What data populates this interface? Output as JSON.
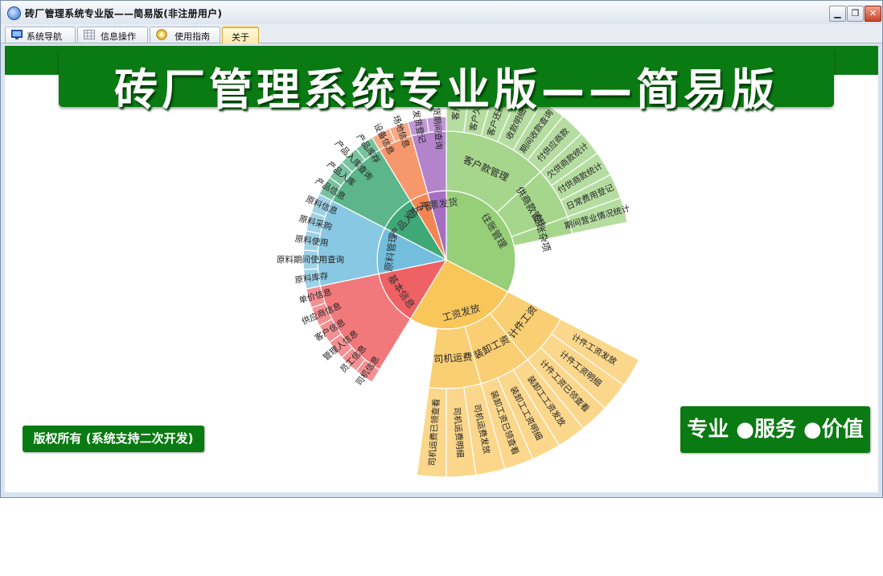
{
  "window": {
    "title": "砖厂管理系统专业版——简易版(非注册用户)",
    "buttons": [
      "minimize",
      "maximize",
      "close"
    ]
  },
  "tabs": [
    {
      "label": "系统导航",
      "icon": "monitor-icon",
      "active": false
    },
    {
      "label": "信息操作",
      "icon": "grid-icon",
      "active": false
    },
    {
      "label": "使用指南",
      "icon": "help-icon",
      "active": false
    },
    {
      "label": "关于",
      "icon": "",
      "active": true
    }
  ],
  "banner": {
    "title": "砖厂管理系统专业版——简易版"
  },
  "copyright": "版权所有 (系统支持二次开发)",
  "slogan": "专业 ●服务 ●价值",
  "sunburst": {
    "groups": [
      {
        "name": "往账管理",
        "color": "#96cf78",
        "size": 15,
        "children": [
          {
            "name": "客户款管理",
            "size": 6,
            "children": [
              "客户欠款",
              "客户欠款统计",
              "客户还款登记",
              "收款明细表",
              "期间收款查询",
              "付供应商款"
            ]
          },
          {
            "name": "供商款管理",
            "size": 3,
            "children": [
              "欠供商款统计",
              "付供商款统计",
              "日常费用登记"
            ]
          },
          {
            "name": "往账杂项",
            "size": 1,
            "children": [
              "期间营业情况统计"
            ]
          }
        ]
      },
      {
        "name": "工资发放",
        "color": "#f9c65a",
        "size": 12,
        "children": [
          {
            "name": "计件工资",
            "size": 3,
            "children": [
              "计件工资发放",
              "计件工资明细",
              "计件工资已领查看"
            ]
          },
          {
            "name": "装卸工资",
            "size": 3,
            "children": [
              "装卸工工资发放",
              "装卸工工资明细",
              "装卸工资已领查看"
            ]
          },
          {
            "name": "司机运费",
            "size": 3,
            "children": [
              "司机运费发放",
              "司机运费明细",
              "司机运费已领查看"
            ]
          }
        ]
      },
      {
        "name": "基本信息",
        "color": "#ee6165",
        "size": 6,
        "children": [
          {
            "name": "基本信息",
            "size": 6,
            "children": [
              "司机信息",
              "员工信息",
              "管理人信息",
              "客户信息",
              "供应商信息",
              "单价信息"
            ]
          }
        ]
      },
      {
        "name": "原料管理",
        "color": "#74bedd",
        "size": 5,
        "children": [
          {
            "name": "原料管理",
            "size": 5,
            "children": [
              "原料库存",
              "原料期间使用查询",
              "原料使用",
              "原料采购",
              "原料信息"
            ]
          }
        ]
      },
      {
        "name": "产品入库",
        "color": "#3fa877",
        "size": 4,
        "children": [
          {
            "name": "产品入库",
            "size": 4,
            "children": [
              "产品信息",
              "产品入库",
              "产品入库查询",
              "产品库存"
            ]
          }
        ]
      },
      {
        "name": "资产管理",
        "color": "#f48552",
        "size": 2,
        "children": [
          {
            "name": "资产管理",
            "size": 2,
            "children": [
              "设备信息",
              "场地信息"
            ]
          }
        ]
      },
      {
        "name": "开票发货",
        "color": "#a56ec3",
        "size": 2,
        "children": [
          {
            "name": "开票发货",
            "size": 2,
            "children": [
              "发货登记",
              "发货期间查询"
            ]
          }
        ]
      }
    ]
  }
}
